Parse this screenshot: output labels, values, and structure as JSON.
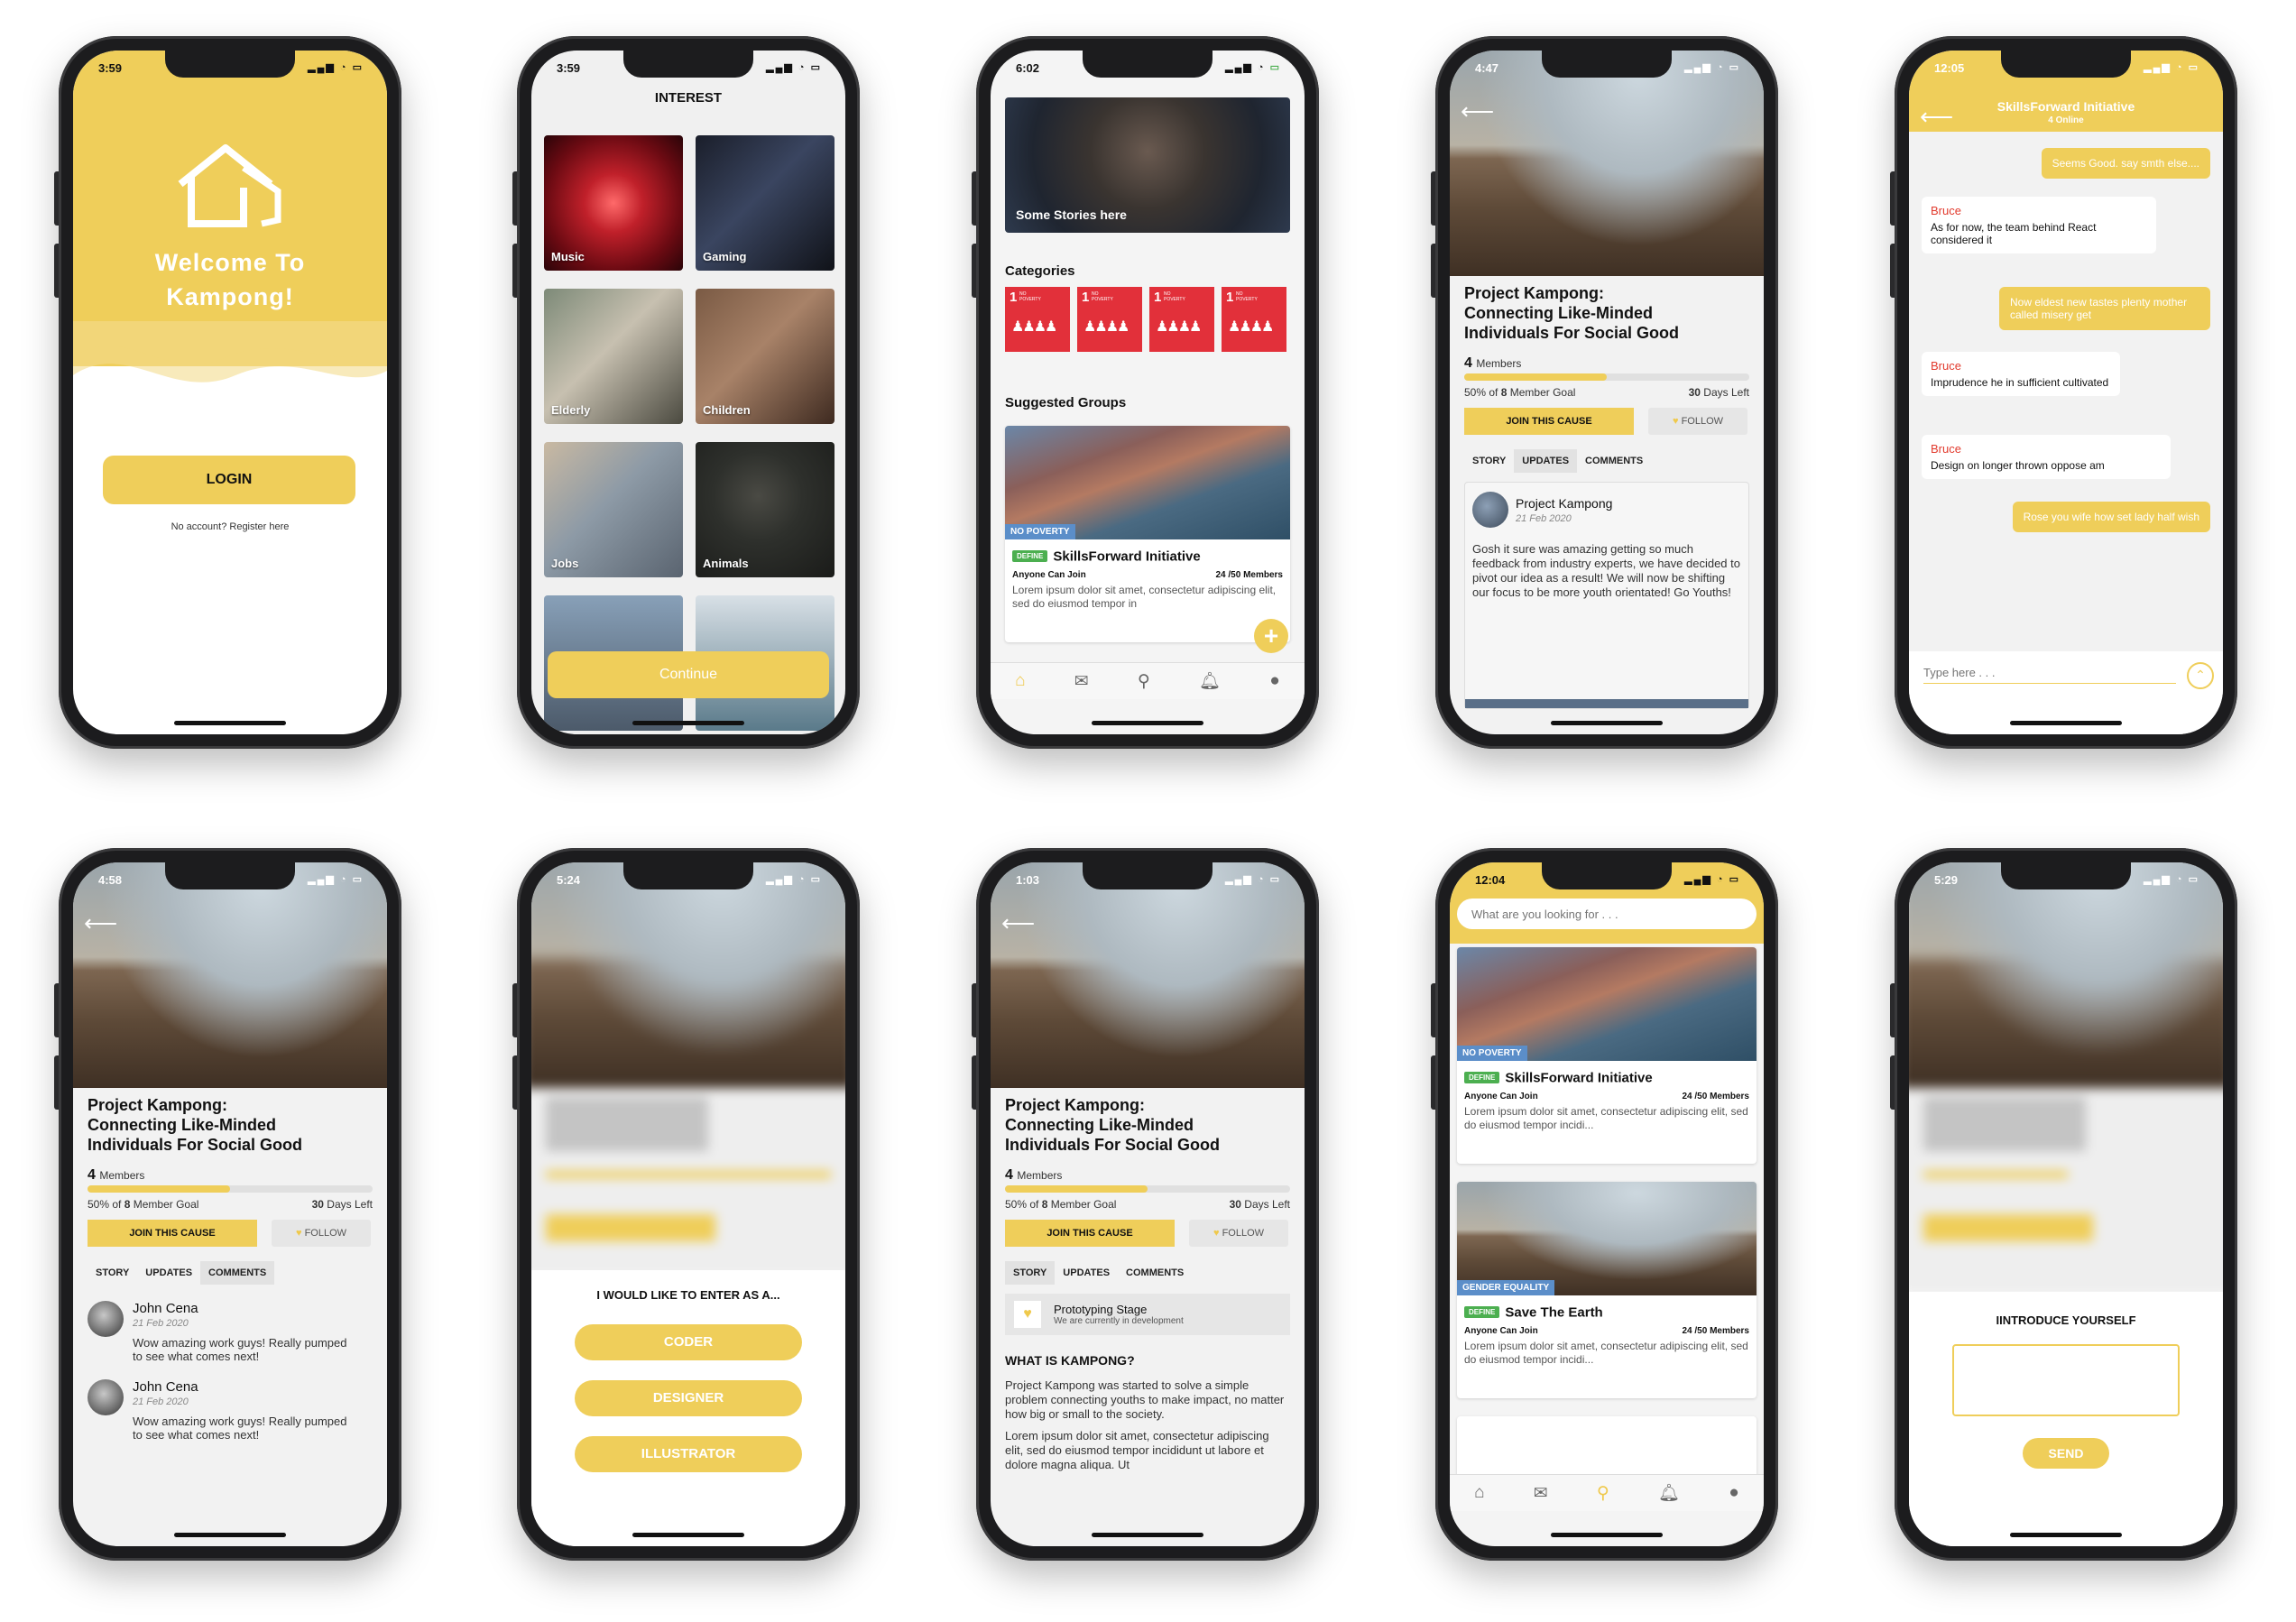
{
  "welcome": {
    "time": "3:59",
    "title": "Welcome To\nKampong!",
    "login": "LOGIN",
    "register": "No account? Register here"
  },
  "interest": {
    "time": "3:59",
    "heading": "INTEREST",
    "tiles": [
      "Music",
      "Gaming",
      "Elderly",
      "Children",
      "Jobs",
      "Animals"
    ],
    "continue": "Continue"
  },
  "home": {
    "time": "6:02",
    "story": "Some Stories here",
    "categories_heading": "Categories",
    "category_badge": "1",
    "category_text": "NO POVERTY",
    "suggested_heading": "Suggested Groups",
    "group": {
      "tag": "NO POVERTY",
      "define": "DEFINE",
      "name": "SkillsForward Initiative",
      "join": "Anyone Can Join",
      "members": "24 /50 Members",
      "desc": "Lorem ipsum dolor sit amet, consectetur adipiscing elit, sed do eiusmod tempor in"
    }
  },
  "project": {
    "title": "Project Kampong:\nConnecting Like-Minded\nIndividuals For Social Good",
    "members_count": "4",
    "members_label": "Members",
    "goal_prefix": "50% of",
    "goal_count": "8",
    "goal_suffix": "Member Goal",
    "days_count": "30",
    "days_label": "Days Left",
    "progress": 0.5,
    "join": "JOIN THIS CAUSE",
    "follow": "FOLLOW",
    "tabs": [
      "STORY",
      "UPDATES",
      "COMMENTS"
    ]
  },
  "updates": {
    "time": "4:47",
    "author": "Project Kampong",
    "date": "21 Feb 2020",
    "body": "Gosh it sure was amazing getting so much feedback from industry experts, we have decided to pivot our idea as a result! We will now be shifting our focus to be more youth orientated! Go Youths!"
  },
  "chat": {
    "time": "12:05",
    "title": "SkillsForward Initiative",
    "online": "4 Online",
    "messages": [
      {
        "me": true,
        "text": "Seems Good. say smth else...."
      },
      {
        "me": false,
        "name": "Bruce",
        "text": "As for now, the team behind React considered it"
      },
      {
        "me": true,
        "text": "Now eldest new tastes plenty mother called misery get"
      },
      {
        "me": false,
        "name": "Bruce",
        "text": "Imprudence he in sufficient cultivated"
      },
      {
        "me": false,
        "name": "Bruce",
        "text": "Design on longer thrown oppose am"
      },
      {
        "me": true,
        "text": "Rose you wife how set lady half wish"
      }
    ],
    "placeholder": "Type here . . ."
  },
  "comments": {
    "time": "4:58",
    "items": [
      {
        "name": "John Cena",
        "date": "21 Feb 2020",
        "text": "Wow amazing work guys! Really pumped to see what comes next!"
      },
      {
        "name": "John Cena",
        "date": "21 Feb 2020",
        "text": "Wow amazing work guys! Really pumped to see what comes next!"
      }
    ]
  },
  "role": {
    "time": "5:24",
    "heading": "I WOULD LIKE TO ENTER AS A...",
    "options": [
      "CODER",
      "DESIGNER",
      "ILLUSTRATOR"
    ]
  },
  "story": {
    "time": "1:03",
    "stage_title": "Prototyping Stage",
    "stage_sub": "We are currently in development",
    "what_heading": "WHAT IS KAMPONG?",
    "para1": "Project Kampong was started to solve a simple problem connecting youths to make impact, no matter how big or small to the society.",
    "para2": "Lorem ipsum dolor sit amet, consectetur adipiscing elit, sed do eiusmod tempor incididunt ut labore et dolore magna aliqua. Ut"
  },
  "search": {
    "time": "12:04",
    "placeholder": "What are you looking for . . .",
    "cards": [
      {
        "tag": "NO POVERTY",
        "define": "DEFINE",
        "name": "SkillsForward Initiative",
        "join": "Anyone Can Join",
        "members": "24 /50 Members",
        "desc": "Lorem ipsum dolor sit amet, consectetur adipiscing elit, sed do eiusmod tempor incidi..."
      },
      {
        "tag": "GENDER EQUALITY",
        "define": "DEFINE",
        "name": "Save The Earth",
        "join": "Anyone Can Join",
        "members": "24 /50 Members",
        "desc": "Lorem ipsum dolor sit amet, consectetur adipiscing elit, sed do eiusmod tempor incidi..."
      }
    ]
  },
  "intro": {
    "time": "5:29",
    "heading": "IINTRODUCE YOURSELF",
    "send": "SEND"
  },
  "icons": {
    "back": "arrow-left-icon",
    "home": "home-icon",
    "mail": "mail-icon",
    "search": "search-icon",
    "bell": "bell-icon",
    "user": "user-icon",
    "heart": "heart-icon",
    "send": "chevron-up-icon"
  },
  "colors": {
    "accent": "#efce5a",
    "define": "#4caf50",
    "tag": "#5b8ec9",
    "name": "#e23b2e"
  }
}
